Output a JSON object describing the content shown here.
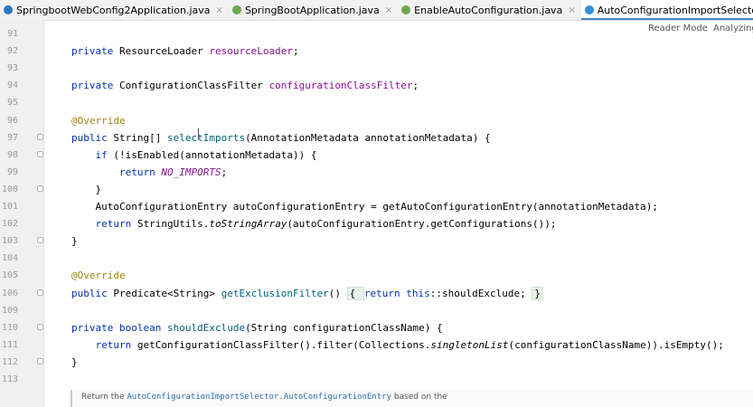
{
  "tabs": [
    {
      "label": "SpringbootWebConfig2Application.java",
      "icon": "java-main-icon",
      "active": false
    },
    {
      "label": "SpringBootApplication.java",
      "icon": "spring-boot-icon",
      "active": false
    },
    {
      "label": "EnableAutoConfiguration.java",
      "icon": "spring-boot-icon",
      "active": false
    },
    {
      "label": "AutoConfigurationImportSelector.java",
      "icon": "java-class-icon",
      "active": true
    }
  ],
  "tab_close_glyph": "×",
  "status": {
    "reader_mode": "Reader Mode",
    "analyzing": "Analyzing..."
  },
  "lines": [
    {
      "num": "91",
      "tokens": []
    },
    {
      "num": "92",
      "tokens": [
        {
          "t": "private ",
          "c": "kw"
        },
        {
          "t": "ResourceLoader "
        },
        {
          "t": "resourceLoader",
          "c": "field"
        },
        {
          "t": ";"
        }
      ]
    },
    {
      "num": "93",
      "tokens": []
    },
    {
      "num": "94",
      "tokens": [
        {
          "t": "private ",
          "c": "kw"
        },
        {
          "t": "ConfigurationClassFilter "
        },
        {
          "t": "configurationClassFilter",
          "c": "field"
        },
        {
          "t": ";"
        }
      ]
    },
    {
      "num": "95",
      "tokens": []
    },
    {
      "num": "96",
      "tokens": [
        {
          "t": "@Override",
          "c": "ann"
        }
      ]
    },
    {
      "num": "97",
      "fold": true,
      "tokens": [
        {
          "t": "public ",
          "c": "kw"
        },
        {
          "t": "String[] "
        },
        {
          "t": "selectImports",
          "c": "method"
        },
        {
          "t": "(AnnotationMetadata annotationMetadata) {"
        }
      ]
    },
    {
      "num": "98",
      "fold": true,
      "tokens": [
        {
          "t": "    "
        },
        {
          "t": "if ",
          "c": "kw"
        },
        {
          "t": "(!isEnabled(annotationMetadata)) {"
        }
      ]
    },
    {
      "num": "99",
      "tokens": [
        {
          "t": "        "
        },
        {
          "t": "return ",
          "c": "kw"
        },
        {
          "t": "NO_IMPORTS",
          "c": "constf"
        },
        {
          "t": ";"
        }
      ]
    },
    {
      "num": "100",
      "fold": true,
      "tokens": [
        {
          "t": "    }"
        }
      ]
    },
    {
      "num": "101",
      "tokens": [
        {
          "t": "    AutoConfigurationEntry autoConfigurationEntry = getAutoConfigurationEntry(annotationMetadata);"
        }
      ]
    },
    {
      "num": "102",
      "tokens": [
        {
          "t": "    "
        },
        {
          "t": "return ",
          "c": "kw"
        },
        {
          "t": "StringUtils."
        },
        {
          "t": "toStringArray",
          "c": "italic"
        },
        {
          "t": "(autoConfigurationEntry.getConfigurations());"
        }
      ]
    },
    {
      "num": "103",
      "fold": true,
      "tokens": [
        {
          "t": "}"
        }
      ]
    },
    {
      "num": "104",
      "tokens": []
    },
    {
      "num": "105",
      "tokens": [
        {
          "t": "@Override",
          "c": "ann"
        }
      ]
    },
    {
      "num": "106",
      "fold": true,
      "tokens": [
        {
          "t": "public ",
          "c": "kw"
        },
        {
          "t": "Predicate<String> "
        },
        {
          "t": "getExclusionFilter",
          "c": "method"
        },
        {
          "t": "() "
        },
        {
          "t": "{ ",
          "c": "foldbox-open"
        },
        {
          "t": "return ",
          "c": "kw"
        },
        {
          "t": "this",
          "c": "kw"
        },
        {
          "t": "::shouldExclude; "
        },
        {
          "t": "}",
          "c": "foldbox-close"
        }
      ]
    },
    {
      "num": "109",
      "tokens": []
    },
    {
      "num": "110",
      "fold": true,
      "tokens": [
        {
          "t": "private ",
          "c": "kw"
        },
        {
          "t": "boolean ",
          "c": "kw"
        },
        {
          "t": "shouldExclude",
          "c": "method"
        },
        {
          "t": "(String configurationClassName) {"
        }
      ]
    },
    {
      "num": "111",
      "tokens": [
        {
          "t": "    "
        },
        {
          "t": "return ",
          "c": "kw"
        },
        {
          "t": "getConfigurationClassFilter().filter(Collections."
        },
        {
          "t": "singletonList",
          "c": "italic"
        },
        {
          "t": "(configurationClassName)).isEmpty();"
        }
      ]
    },
    {
      "num": "112",
      "fold": true,
      "tokens": [
        {
          "t": "}"
        }
      ]
    },
    {
      "num": "113",
      "tokens": []
    }
  ],
  "doc": {
    "prefix": "Return the ",
    "code": "AutoConfigurationImportSelector.AutoConfigurationEntry",
    "suffix": " based on the"
  },
  "colors": {
    "keyword": "#0033b3",
    "field": "#871094",
    "method": "#00627a",
    "annotation": "#9e880d",
    "active_tab_underline": "#4083c9"
  }
}
